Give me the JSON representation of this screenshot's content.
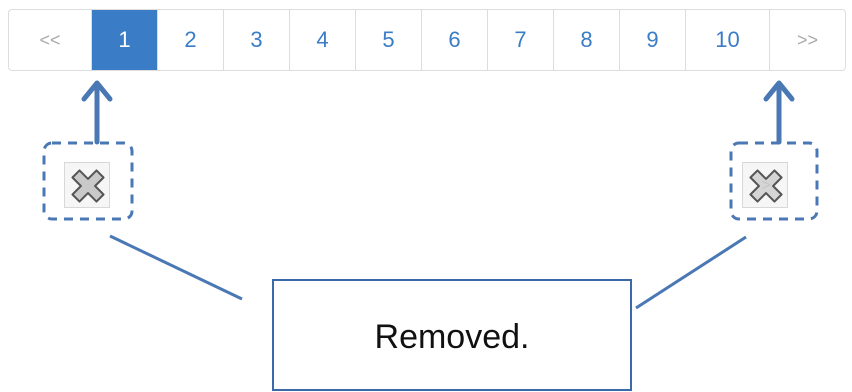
{
  "pagination": {
    "first_label": "<<",
    "last_label": ">>",
    "pages": [
      "1",
      "2",
      "3",
      "4",
      "5",
      "6",
      "7",
      "8",
      "9",
      "10"
    ],
    "active_page": "1"
  },
  "removed_controls": {
    "left_hidden_glyph": "<",
    "right_hidden_glyph": ">"
  },
  "callout": {
    "text": "Removed."
  },
  "colors": {
    "accent": "#3a7cc6",
    "annotation": "#4a78b5",
    "border": "#dddddd"
  }
}
